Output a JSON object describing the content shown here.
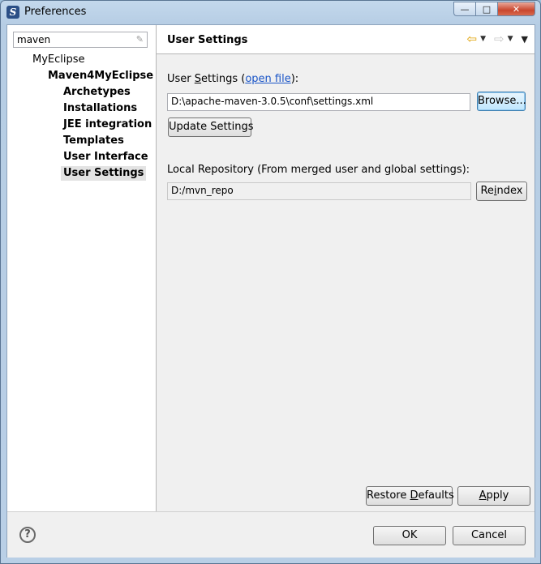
{
  "window": {
    "title": "Preferences"
  },
  "filter": {
    "value": "maven"
  },
  "tree": [
    {
      "label": "MyEclipse",
      "level": 0,
      "bold": false,
      "selected": false
    },
    {
      "label": "Maven4MyEclipse",
      "level": 1,
      "bold": true,
      "selected": false
    },
    {
      "label": "Archetypes",
      "level": 2,
      "bold": true,
      "selected": false
    },
    {
      "label": "Installations",
      "level": 2,
      "bold": true,
      "selected": false
    },
    {
      "label": "JEE integration",
      "level": 2,
      "bold": true,
      "selected": false
    },
    {
      "label": "Templates",
      "level": 2,
      "bold": true,
      "selected": false
    },
    {
      "label": "User Interface",
      "level": 2,
      "bold": true,
      "selected": false
    },
    {
      "label": "User Settings",
      "level": 2,
      "bold": true,
      "selected": true
    }
  ],
  "page": {
    "title": "User Settings",
    "user_settings_label_pre": "User ",
    "user_settings_label_u": "S",
    "user_settings_label_post": "ettings (",
    "open_file_link": "open file",
    "user_settings_label_close": "):",
    "user_settings_path": "D:\\apache-maven-3.0.5\\conf\\settings.xml",
    "browse_button": "Browse...",
    "update_button": "Update Settings",
    "local_repo_label": "Local Repository (From merged user and global settings):",
    "local_repo_path": "D:/mvn_repo",
    "reindex_pre": "Re",
    "reindex_u": "i",
    "reindex_post": "ndex",
    "restore_pre": "Restore ",
    "restore_u": "D",
    "restore_post": "efaults",
    "apply_pre": "",
    "apply_u": "A",
    "apply_post": "pply"
  },
  "footer": {
    "ok": "OK",
    "cancel": "Cancel"
  },
  "icons": {
    "app": "myeclipse-logo-icon",
    "back": "back-arrow-icon",
    "forward": "forward-arrow-icon",
    "help": "help-icon",
    "clear": "clear-filter-icon"
  },
  "colors": {
    "link": "#1a55c7",
    "close_button": "#c9462d",
    "selected_tree": "#e3e3e3"
  }
}
